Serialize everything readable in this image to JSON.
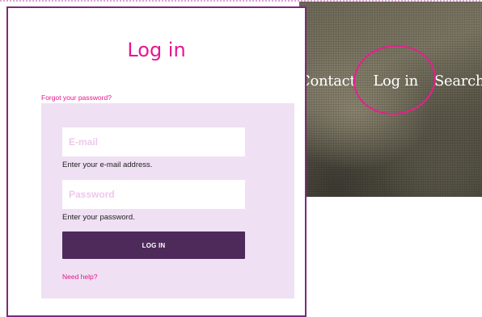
{
  "nav": {
    "contact": "Contact",
    "login": "Log in",
    "search": "Search"
  },
  "login_panel": {
    "title": "Log in",
    "forgot_password": "Forgot your password?",
    "email_placeholder": "E-mail",
    "email_hint": "Enter your e-mail address.",
    "password_placeholder": "Password",
    "password_hint": "Enter your password.",
    "submit_label": "LOG IN",
    "help_link": "Need help?"
  },
  "colors": {
    "accent_pink": "#e6168f",
    "panel_border": "#7b2b78",
    "form_background": "#efe0f3",
    "button_background": "#4d2a5a"
  }
}
